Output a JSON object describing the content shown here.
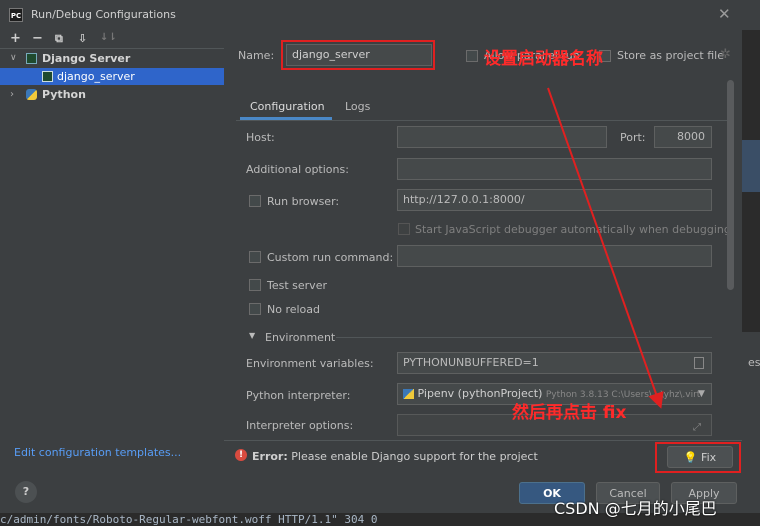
{
  "window": {
    "title": "Run/Debug Configurations",
    "app_logo_text": "PC"
  },
  "toolbar": {
    "add": "+",
    "remove": "−",
    "copy": "⧉",
    "move": "⇩",
    "sort": "↓⇂"
  },
  "tree": {
    "group_label": "Django Server",
    "child_label": "django_server",
    "python_label": "Python"
  },
  "left_footer": {
    "edit_templates": "Edit configuration templates..."
  },
  "name_row": {
    "label": "Name:",
    "value": "django_server",
    "allow_parallel": "Allow parallel run",
    "store_as_project": "Store as project file"
  },
  "tabs": [
    "Configuration",
    "Logs"
  ],
  "config": {
    "host_label": "Host:",
    "host_value": "",
    "port_label": "Port:",
    "port_value": "8000",
    "additional_label": "Additional options:",
    "additional_value": "",
    "run_browser_label": "Run browser:",
    "run_browser_value": "http://127.0.0.1:8000/",
    "start_js_label": "Start JavaScript debugger automatically when debugging",
    "custom_run_label": "Custom run command:",
    "custom_run_value": "",
    "test_server_label": "Test server",
    "no_reload_label": "No reload",
    "environment_label": "Environment",
    "env_vars_label": "Environment variables:",
    "env_vars_value": "PYTHONUNBUFFERED=1",
    "interpreter_label": "Python interpreter:",
    "interpreter_value": "Pipenv (pythonProject)",
    "interpreter_detail": "Python 3.8.13 C:\\Users\\...\\yhz\\.virt",
    "interp_options_label": "Interpreter options:"
  },
  "error": {
    "prefix": "Error:",
    "message": "Please enable Django support for the project",
    "fix_label": "Fix"
  },
  "buttons": {
    "help": "?",
    "ok": "OK",
    "cancel": "Cancel",
    "apply": "Apply"
  },
  "background": {
    "terminal_line": "c/admin/fonts/Roboto-Regular-webfont.woff HTTP/1.1\" 304 0",
    "side_char": "es"
  },
  "annotations": {
    "set_name": "设置启动器名称",
    "then_fix": "然后再点击 fix",
    "watermark": "CSDN @七月的小尾巴"
  },
  "colors": {
    "accent": "#2f65ca",
    "link": "#589df6",
    "annotation": "#e02020",
    "ok_button": "#365880"
  }
}
